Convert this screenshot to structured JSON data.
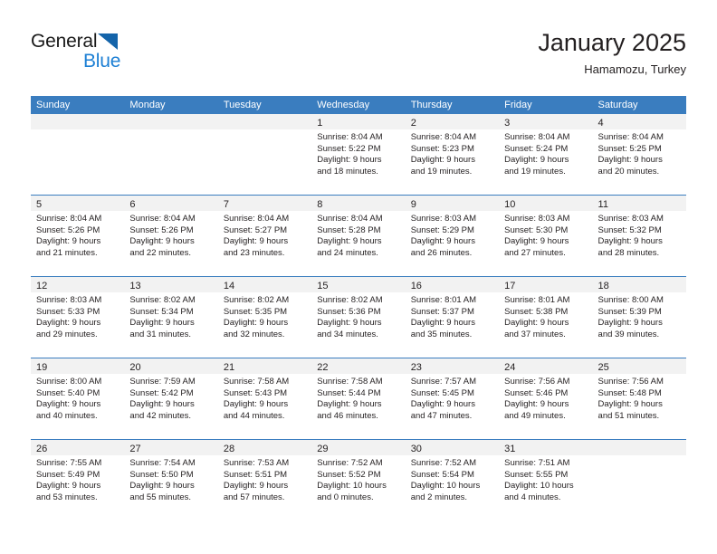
{
  "brand": {
    "name_part1": "General",
    "name_part2": "Blue",
    "triangle_color": "#1464aa",
    "blue_color": "#1c7fd4"
  },
  "header": {
    "title": "January 2025",
    "subtitle": "Hamamozu, Turkey"
  },
  "theme": {
    "header_blue": "#3a7dbf",
    "day_band_gray": "#f2f2f2",
    "text": "#231f20"
  },
  "weekdays": [
    "Sunday",
    "Monday",
    "Tuesday",
    "Wednesday",
    "Thursday",
    "Friday",
    "Saturday"
  ],
  "weeks": [
    [
      {
        "day": "",
        "lines": []
      },
      {
        "day": "",
        "lines": []
      },
      {
        "day": "",
        "lines": []
      },
      {
        "day": "1",
        "lines": [
          "Sunrise: 8:04 AM",
          "Sunset: 5:22 PM",
          "Daylight: 9 hours",
          "and 18 minutes."
        ]
      },
      {
        "day": "2",
        "lines": [
          "Sunrise: 8:04 AM",
          "Sunset: 5:23 PM",
          "Daylight: 9 hours",
          "and 19 minutes."
        ]
      },
      {
        "day": "3",
        "lines": [
          "Sunrise: 8:04 AM",
          "Sunset: 5:24 PM",
          "Daylight: 9 hours",
          "and 19 minutes."
        ]
      },
      {
        "day": "4",
        "lines": [
          "Sunrise: 8:04 AM",
          "Sunset: 5:25 PM",
          "Daylight: 9 hours",
          "and 20 minutes."
        ]
      }
    ],
    [
      {
        "day": "5",
        "lines": [
          "Sunrise: 8:04 AM",
          "Sunset: 5:26 PM",
          "Daylight: 9 hours",
          "and 21 minutes."
        ]
      },
      {
        "day": "6",
        "lines": [
          "Sunrise: 8:04 AM",
          "Sunset: 5:26 PM",
          "Daylight: 9 hours",
          "and 22 minutes."
        ]
      },
      {
        "day": "7",
        "lines": [
          "Sunrise: 8:04 AM",
          "Sunset: 5:27 PM",
          "Daylight: 9 hours",
          "and 23 minutes."
        ]
      },
      {
        "day": "8",
        "lines": [
          "Sunrise: 8:04 AM",
          "Sunset: 5:28 PM",
          "Daylight: 9 hours",
          "and 24 minutes."
        ]
      },
      {
        "day": "9",
        "lines": [
          "Sunrise: 8:03 AM",
          "Sunset: 5:29 PM",
          "Daylight: 9 hours",
          "and 26 minutes."
        ]
      },
      {
        "day": "10",
        "lines": [
          "Sunrise: 8:03 AM",
          "Sunset: 5:30 PM",
          "Daylight: 9 hours",
          "and 27 minutes."
        ]
      },
      {
        "day": "11",
        "lines": [
          "Sunrise: 8:03 AM",
          "Sunset: 5:32 PM",
          "Daylight: 9 hours",
          "and 28 minutes."
        ]
      }
    ],
    [
      {
        "day": "12",
        "lines": [
          "Sunrise: 8:03 AM",
          "Sunset: 5:33 PM",
          "Daylight: 9 hours",
          "and 29 minutes."
        ]
      },
      {
        "day": "13",
        "lines": [
          "Sunrise: 8:02 AM",
          "Sunset: 5:34 PM",
          "Daylight: 9 hours",
          "and 31 minutes."
        ]
      },
      {
        "day": "14",
        "lines": [
          "Sunrise: 8:02 AM",
          "Sunset: 5:35 PM",
          "Daylight: 9 hours",
          "and 32 minutes."
        ]
      },
      {
        "day": "15",
        "lines": [
          "Sunrise: 8:02 AM",
          "Sunset: 5:36 PM",
          "Daylight: 9 hours",
          "and 34 minutes."
        ]
      },
      {
        "day": "16",
        "lines": [
          "Sunrise: 8:01 AM",
          "Sunset: 5:37 PM",
          "Daylight: 9 hours",
          "and 35 minutes."
        ]
      },
      {
        "day": "17",
        "lines": [
          "Sunrise: 8:01 AM",
          "Sunset: 5:38 PM",
          "Daylight: 9 hours",
          "and 37 minutes."
        ]
      },
      {
        "day": "18",
        "lines": [
          "Sunrise: 8:00 AM",
          "Sunset: 5:39 PM",
          "Daylight: 9 hours",
          "and 39 minutes."
        ]
      }
    ],
    [
      {
        "day": "19",
        "lines": [
          "Sunrise: 8:00 AM",
          "Sunset: 5:40 PM",
          "Daylight: 9 hours",
          "and 40 minutes."
        ]
      },
      {
        "day": "20",
        "lines": [
          "Sunrise: 7:59 AM",
          "Sunset: 5:42 PM",
          "Daylight: 9 hours",
          "and 42 minutes."
        ]
      },
      {
        "day": "21",
        "lines": [
          "Sunrise: 7:58 AM",
          "Sunset: 5:43 PM",
          "Daylight: 9 hours",
          "and 44 minutes."
        ]
      },
      {
        "day": "22",
        "lines": [
          "Sunrise: 7:58 AM",
          "Sunset: 5:44 PM",
          "Daylight: 9 hours",
          "and 46 minutes."
        ]
      },
      {
        "day": "23",
        "lines": [
          "Sunrise: 7:57 AM",
          "Sunset: 5:45 PM",
          "Daylight: 9 hours",
          "and 47 minutes."
        ]
      },
      {
        "day": "24",
        "lines": [
          "Sunrise: 7:56 AM",
          "Sunset: 5:46 PM",
          "Daylight: 9 hours",
          "and 49 minutes."
        ]
      },
      {
        "day": "25",
        "lines": [
          "Sunrise: 7:56 AM",
          "Sunset: 5:48 PM",
          "Daylight: 9 hours",
          "and 51 minutes."
        ]
      }
    ],
    [
      {
        "day": "26",
        "lines": [
          "Sunrise: 7:55 AM",
          "Sunset: 5:49 PM",
          "Daylight: 9 hours",
          "and 53 minutes."
        ]
      },
      {
        "day": "27",
        "lines": [
          "Sunrise: 7:54 AM",
          "Sunset: 5:50 PM",
          "Daylight: 9 hours",
          "and 55 minutes."
        ]
      },
      {
        "day": "28",
        "lines": [
          "Sunrise: 7:53 AM",
          "Sunset: 5:51 PM",
          "Daylight: 9 hours",
          "and 57 minutes."
        ]
      },
      {
        "day": "29",
        "lines": [
          "Sunrise: 7:52 AM",
          "Sunset: 5:52 PM",
          "Daylight: 10 hours",
          "and 0 minutes."
        ]
      },
      {
        "day": "30",
        "lines": [
          "Sunrise: 7:52 AM",
          "Sunset: 5:54 PM",
          "Daylight: 10 hours",
          "and 2 minutes."
        ]
      },
      {
        "day": "31",
        "lines": [
          "Sunrise: 7:51 AM",
          "Sunset: 5:55 PM",
          "Daylight: 10 hours",
          "and 4 minutes."
        ]
      },
      {
        "day": "",
        "lines": []
      }
    ]
  ]
}
